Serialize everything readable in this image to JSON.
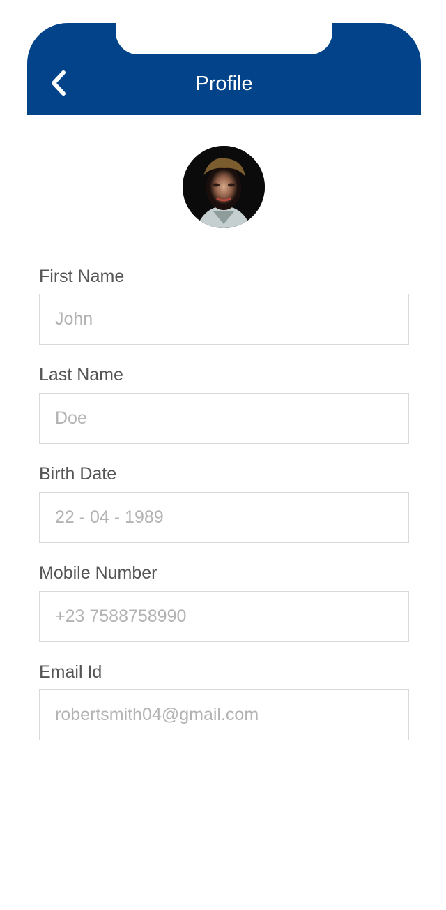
{
  "header": {
    "title": "Profile",
    "back_icon": "chevron-left-icon"
  },
  "colors": {
    "header_bg": "#02438a",
    "label_text": "#555555",
    "input_text": "#b3b3b3",
    "input_border": "#d9d9d9"
  },
  "form": {
    "fields": [
      {
        "label": "First Name",
        "value": "John"
      },
      {
        "label": "Last Name",
        "value": "Doe"
      },
      {
        "label": "Birth Date",
        "value": "22 - 04 - 1989"
      },
      {
        "label": "Mobile Number",
        "value": "+23 7588758990"
      },
      {
        "label": "Email Id",
        "value": "robertsmith04@gmail.com"
      }
    ]
  }
}
